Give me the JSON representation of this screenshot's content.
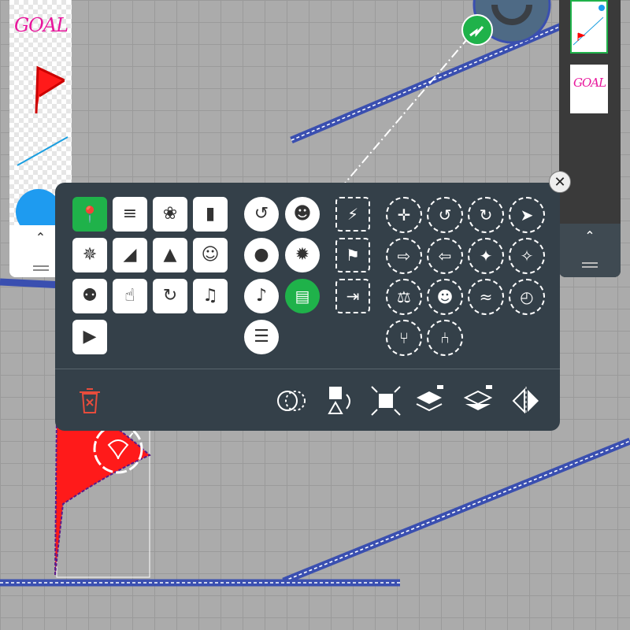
{
  "left_panel": {
    "items": [
      {
        "name": "goal-sticker",
        "label": "GOAL"
      },
      {
        "name": "red-flag"
      },
      {
        "name": "blue-line"
      },
      {
        "name": "blue-ball"
      }
    ],
    "collapse_icon": "chevron-up-icon",
    "grip_icon": "grip-icon"
  },
  "right_panel": {
    "pages": [
      {
        "name": "level-page-1",
        "selected": true
      },
      {
        "name": "level-page-2",
        "label": "GOAL"
      }
    ]
  },
  "popup": {
    "close_icon": "close-icon",
    "object_tiles": [
      "pin-icon",
      "spring-icon",
      "fan-icon",
      "door-icon",
      "burst-icon",
      "treadmill-icon",
      "cannon-icon",
      "astronaut-icon",
      "link-icon",
      "touch-icon",
      "loop-icon",
      "music-tile-icon",
      "video-tile-icon"
    ],
    "action_circles": [
      "rotate-arrow-icon",
      "person-icon",
      "bomb-icon",
      "spark-icon",
      "music-note-icon",
      "book-icon",
      "checklist-icon"
    ],
    "trigger_squares": [
      "lightning-icon",
      "flag-icon",
      "exit-icon"
    ],
    "behavior_circles": [
      "move-all-icon",
      "rotate-ccw-icon",
      "rotate-cw-icon",
      "run-icon",
      "push-icon",
      "pull-icon",
      "expand-icon",
      "shrink-icon",
      "balance-icon",
      "carry-icon",
      "shake-icon",
      "timer-icon",
      "branch-icon",
      "tree-icon"
    ],
    "toolbar": [
      "delete-icon",
      "circle-shape-icon",
      "shape-swap-icon",
      "resize-icon",
      "layer-up-icon",
      "layer-down-icon",
      "flip-icon"
    ]
  },
  "colors": {
    "accent": "#1fb24a",
    "popup_bg": "#344049",
    "goal": "#e8169c",
    "flag": "#ff0000",
    "delete": "#e74c3c"
  }
}
